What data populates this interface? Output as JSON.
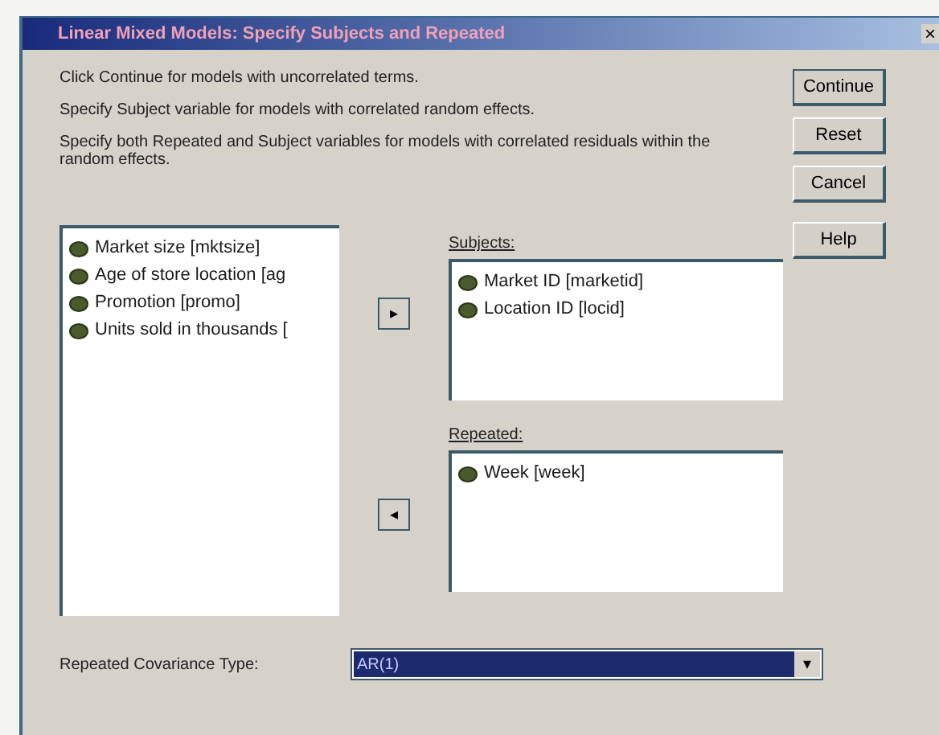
{
  "window": {
    "title": "Linear Mixed Models: Specify Subjects and Repeated",
    "close": "×"
  },
  "instructions": [
    "Click Continue for models with uncorrelated terms.",
    "Specify Subject variable for models with correlated random effects.",
    "Specify both Repeated and Subject variables for models with correlated residuals within the random effects."
  ],
  "buttons": [
    {
      "label": "Continue",
      "default": true
    },
    {
      "label": "Reset",
      "default": false
    },
    {
      "label": "Cancel",
      "default": false
    },
    {
      "label": "Help",
      "default": false
    }
  ],
  "variables": [
    "Market size [mktsize]",
    "Age of store location [ag",
    "Promotion [promo]",
    "Units sold in thousands ["
  ],
  "move_buttons": [
    "▸",
    "◂"
  ],
  "subjects": {
    "label": "Subjects:",
    "items": [
      "Market ID [marketid]",
      "Location ID [locid]"
    ]
  },
  "repeated": {
    "label": "Repeated:",
    "items": [
      "Week [week]"
    ]
  },
  "covariance": {
    "label": "Repeated Covariance Type:",
    "value": "AR(1)",
    "selected": true,
    "caret": "▾"
  }
}
